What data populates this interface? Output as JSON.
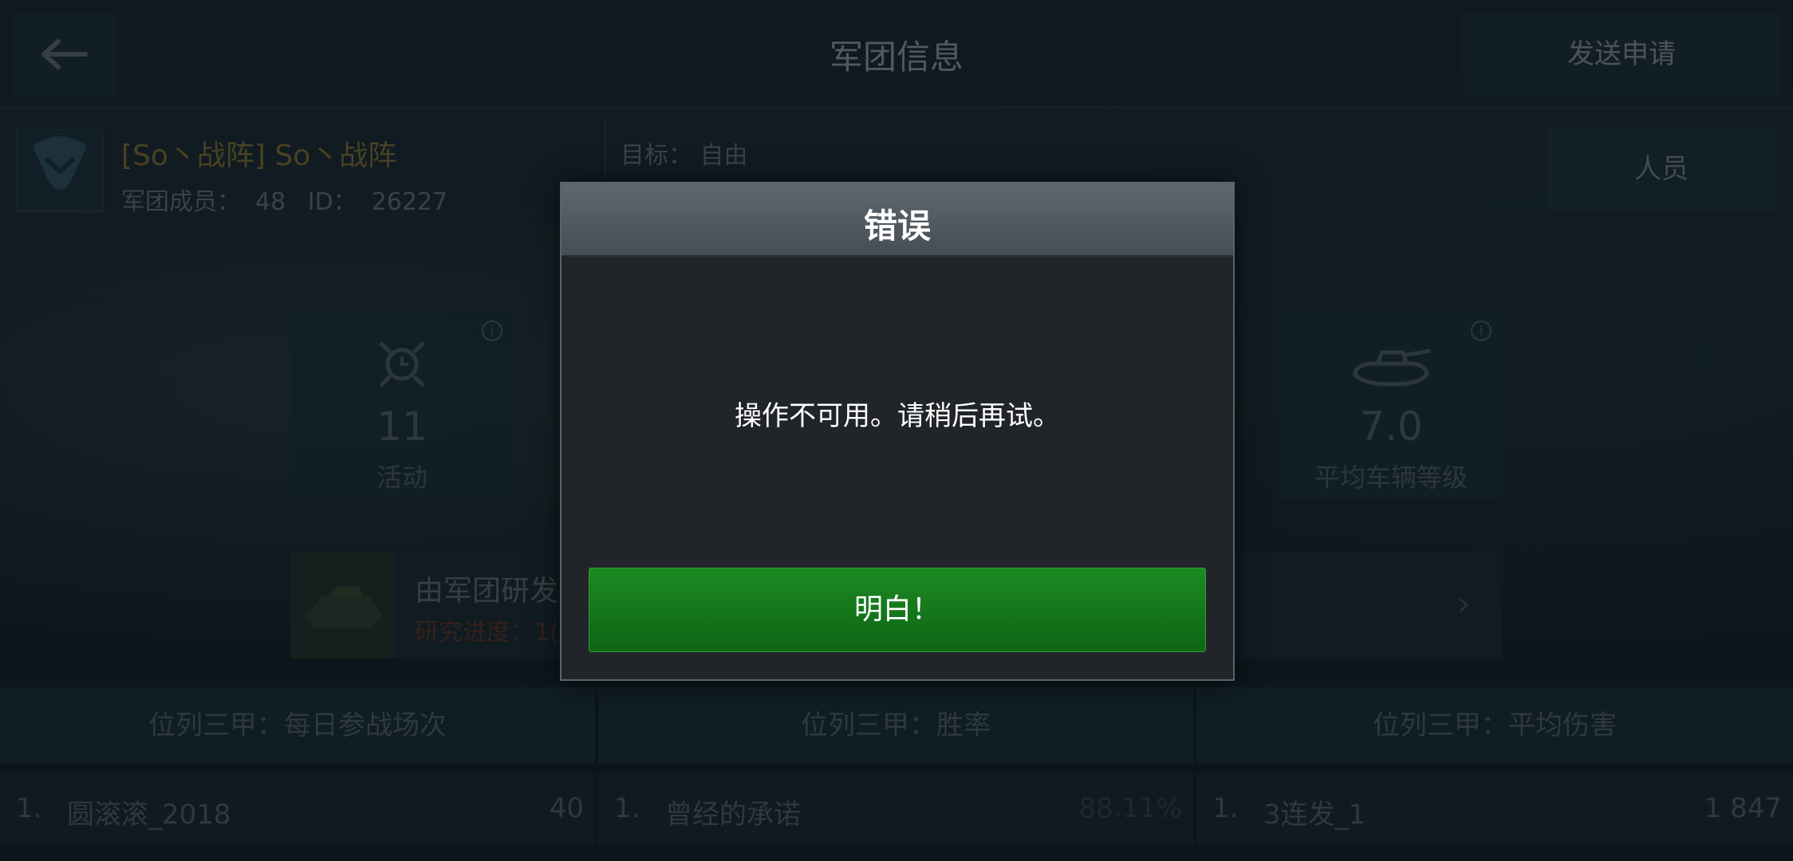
{
  "topbar": {
    "title": "军团信息",
    "send_request": "发送申请"
  },
  "clan": {
    "name": "[So丶战阵] So丶战阵",
    "members_label": "军团成员：",
    "members_count": "48",
    "id_label": "ID：",
    "id_value": "26227",
    "goal_label": "目标：",
    "goal_value": "自由",
    "personnel_button": "人员"
  },
  "stats": [
    {
      "value": "11",
      "label": "活动",
      "icon": "target-clock-icon"
    },
    {
      "value": "7.0",
      "label": "平均车辆等级",
      "icon": "tank-icon"
    }
  ],
  "research": {
    "title": "由军团研发",
    "progress_label": "研究进度：",
    "progress_value": "1("
  },
  "leaderboards": [
    {
      "header": "位列三甲：每日参战场次",
      "rank": "1.",
      "name": "圆滚滚_2018",
      "value": "40"
    },
    {
      "header": "位列三甲：胜率",
      "rank": "1.",
      "name": "曾经的承诺",
      "value": "88.11%"
    },
    {
      "header": "位列三甲：平均伤害",
      "rank": "1.",
      "name": "3连发_1",
      "value": "1 847"
    }
  ],
  "dialog": {
    "title": "错误",
    "message": "操作不可用。请稍后再试。",
    "ok_button": "明白！"
  }
}
